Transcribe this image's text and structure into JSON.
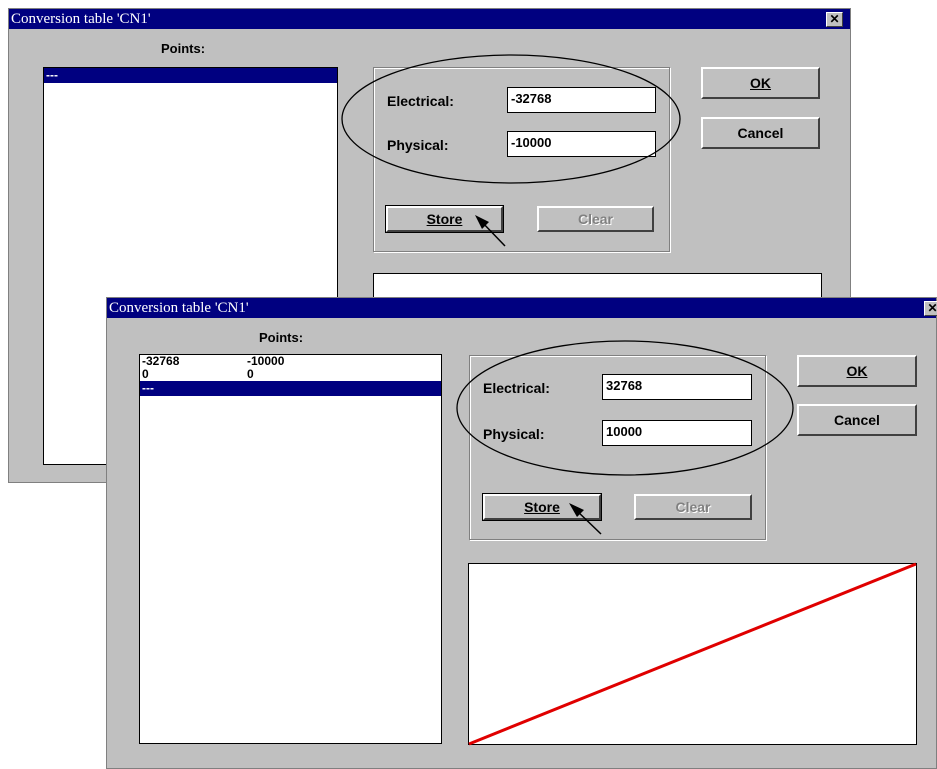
{
  "back_dialog": {
    "title": "Conversion table 'CN1'",
    "close_glyph": "✕",
    "points_label": "Points:",
    "list_rows": [
      {
        "electrical": "---",
        "physical": "",
        "selected": true
      }
    ],
    "electrical_label": "Electrical:",
    "electrical_value": "-32768",
    "physical_label": "Physical:",
    "physical_value": "-10000",
    "store_label": "Store",
    "clear_label": "Clear",
    "ok_label": "OK",
    "cancel_label": "Cancel"
  },
  "front_dialog": {
    "title": "Conversion table 'CN1'",
    "close_glyph": "✕",
    "points_label": "Points:",
    "list_rows": [
      {
        "electrical": "-32768",
        "physical": "-10000",
        "selected": false
      },
      {
        "electrical": "0",
        "physical": "0",
        "selected": false
      },
      {
        "electrical": "---",
        "physical": "",
        "selected": true
      }
    ],
    "electrical_label": "Electrical:",
    "electrical_value": "32768",
    "physical_label": "Physical:",
    "physical_value": "10000",
    "store_label": "Store",
    "clear_label": "Clear",
    "ok_label": "OK",
    "cancel_label": "Cancel",
    "graph_line_color": "#e00000"
  }
}
